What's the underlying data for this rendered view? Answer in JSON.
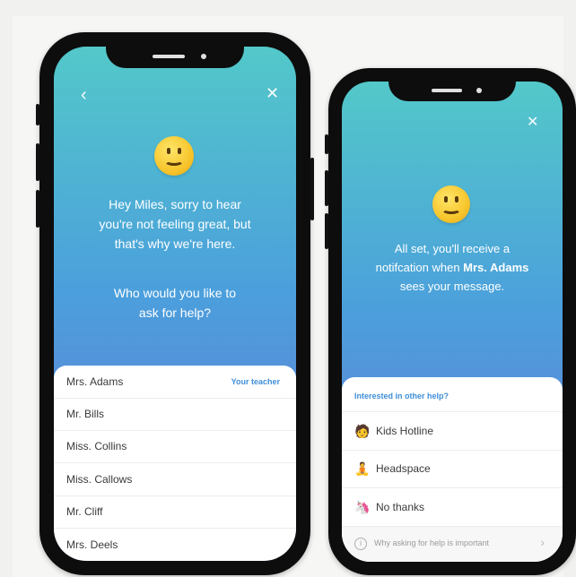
{
  "left": {
    "back_icon": "chevron-left",
    "close_icon": "close",
    "emoji": "slightly-smiling-face",
    "message_line1": "Hey Miles, sorry to hear",
    "message_line2": "you're not feeling great, but",
    "message_line3": "that's why we're here.",
    "question_line1": "Who would you like to",
    "question_line2": "ask for help?",
    "contacts": [
      {
        "name": "Mrs. Adams",
        "tag": "Your teacher"
      },
      {
        "name": "Mr. Bills"
      },
      {
        "name": "Miss. Collins"
      },
      {
        "name": "Miss. Callows"
      },
      {
        "name": "Mr. Cliff"
      },
      {
        "name": "Mrs. Deels"
      }
    ]
  },
  "right": {
    "close_icon": "close",
    "emoji": "slightly-smiling-face",
    "message_line1": "All set, you'll receive a",
    "message_line2_pre": "notifcation when ",
    "message_line2_bold": "Mrs. Adams",
    "message_line3": "sees your message.",
    "heading": "Interested in other help?",
    "options": [
      {
        "label": "Kids Hotline",
        "icon": "person-icon"
      },
      {
        "label": "Headspace",
        "icon": "meditation-icon"
      },
      {
        "label": "No thanks",
        "icon": "unicorn-icon"
      }
    ],
    "footer": "Why asking for help is important",
    "footer_info_icon": "info-icon",
    "footer_chevron_icon": "chevron-right"
  }
}
